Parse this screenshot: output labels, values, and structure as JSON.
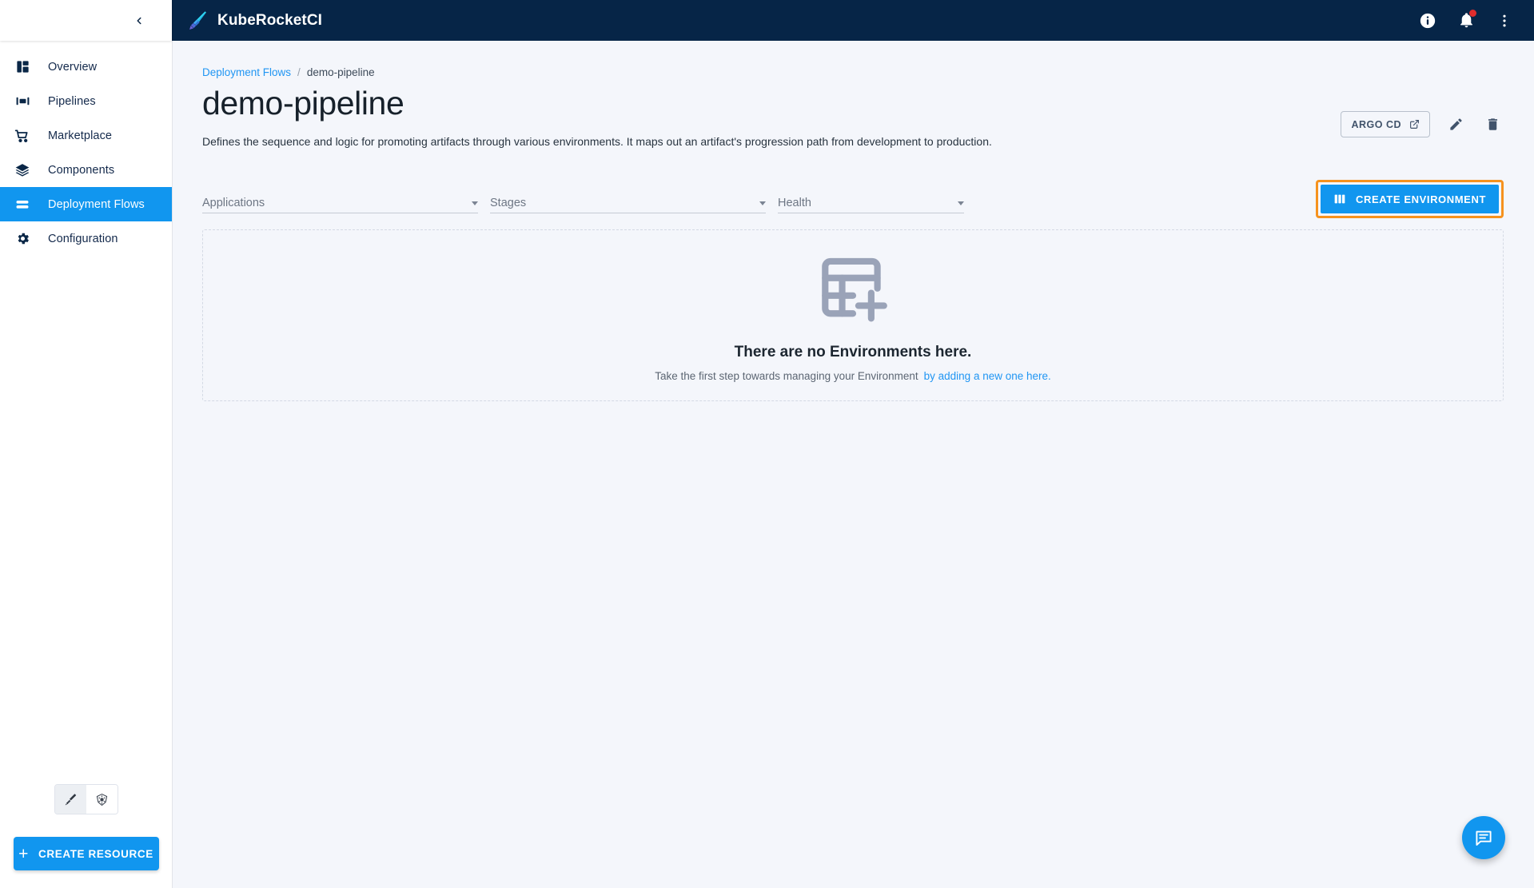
{
  "app": {
    "brand_name": "KubeRocketCI",
    "logo_icon": "rocket-blade-icon"
  },
  "topbar": {
    "info_icon": "info-circle-icon",
    "notifications_icon": "bell-icon",
    "notifications_has_badge": true,
    "overflow_icon": "more-vertical-icon"
  },
  "sidebar": {
    "collapse_icon": "chevron-left-icon",
    "items": [
      {
        "label": "Overview",
        "icon": "dashboard-icon",
        "active": false
      },
      {
        "label": "Pipelines",
        "icon": "pipelines-icon",
        "active": false
      },
      {
        "label": "Marketplace",
        "icon": "shopping-cart-icon",
        "active": false
      },
      {
        "label": "Components",
        "icon": "layers-icon",
        "active": false
      },
      {
        "label": "Deployment Flows",
        "icon": "deployment-flows-icon",
        "active": true
      },
      {
        "label": "Configuration",
        "icon": "gear-icon",
        "active": false
      }
    ],
    "view_toggle": {
      "krci_icon": "rocket-blade-icon",
      "kubernetes_icon": "kubernetes-icon",
      "selected": "krci"
    },
    "create_resource_label": "CREATE RESOURCE",
    "create_resource_icon": "plus-icon"
  },
  "page": {
    "breadcrumb": {
      "parent": "Deployment Flows",
      "separator": "/",
      "current": "demo-pipeline"
    },
    "title": "demo-pipeline",
    "description": "Defines the sequence and logic for promoting artifacts through various environments. It maps out an artifact's progression path from development to production.",
    "actions": {
      "argo_cd_label": "ARGO CD",
      "argo_cd_icon": "external-link-icon",
      "edit_icon": "pencil-icon",
      "delete_icon": "trash-icon"
    }
  },
  "filters": [
    {
      "label": "Applications",
      "value": "",
      "caret_icon": "caret-down-icon"
    },
    {
      "label": "Stages",
      "value": "",
      "caret_icon": "caret-down-icon"
    },
    {
      "label": "Health",
      "value": "",
      "caret_icon": "caret-down-icon"
    }
  ],
  "create_environment": {
    "label": "CREATE ENVIRONMENT",
    "icon": "columns-icon",
    "highlighted": true,
    "highlight_color": "#f6921e"
  },
  "empty_state": {
    "icon": "table-add-icon",
    "title": "There are no Environments here.",
    "subtitle": "Take the first step towards managing your Environment",
    "link_text": "by adding a new one here."
  },
  "chat_fab": {
    "icon": "chat-bubble-icon"
  },
  "colors": {
    "topbar_bg": "#062547",
    "accent_blue": "#1196ef",
    "link_blue": "#2196f3",
    "page_bg": "#f4f6fb",
    "highlight_orange": "#f6921e",
    "badge_red": "#e02d2d"
  }
}
